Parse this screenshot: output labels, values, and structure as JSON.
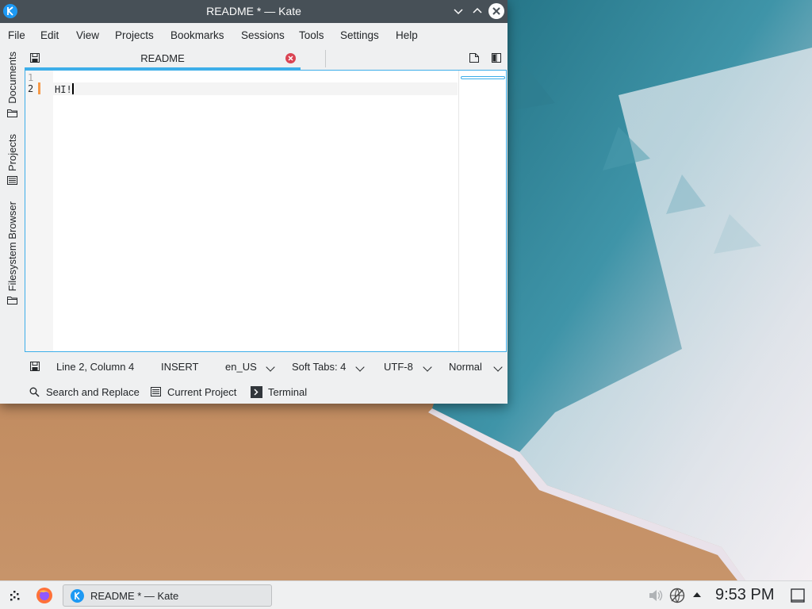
{
  "window": {
    "title": "README * — Kate",
    "controls": [
      "minimize",
      "maximize",
      "close"
    ]
  },
  "menubar": [
    "File",
    "Edit",
    "View",
    "Projects",
    "Bookmarks",
    "Sessions",
    "Tools",
    "Settings",
    "Help"
  ],
  "sidebar": {
    "tabs": [
      {
        "label": "Documents",
        "icon": "folder-icon"
      },
      {
        "label": "Projects",
        "icon": "list-icon"
      },
      {
        "label": "Filesystem Browser",
        "icon": "folder-icon"
      }
    ]
  },
  "tabs": [
    {
      "title": "README",
      "icon": "save-icon",
      "close_icon": "close-tab-icon"
    }
  ],
  "editor": {
    "line_numbers": [
      "1",
      "2"
    ],
    "lines": [
      "",
      "HI!"
    ],
    "current_line": 2
  },
  "statusbar": {
    "position": "Line 2, Column 4",
    "mode": "INSERT",
    "dictionary": "en_US",
    "indentation": "Soft Tabs: 4",
    "encoding": "UTF-8",
    "input_mode": "Normal"
  },
  "bottom_toolbar": [
    "Search and Replace",
    "Current Project",
    "Terminal"
  ],
  "taskbar": {
    "task_label": "README * — Kate",
    "clock": "9:53 PM"
  },
  "colors": {
    "accent": "#3daee9",
    "titlebar": "#475057",
    "close_tab": "#da4453"
  }
}
